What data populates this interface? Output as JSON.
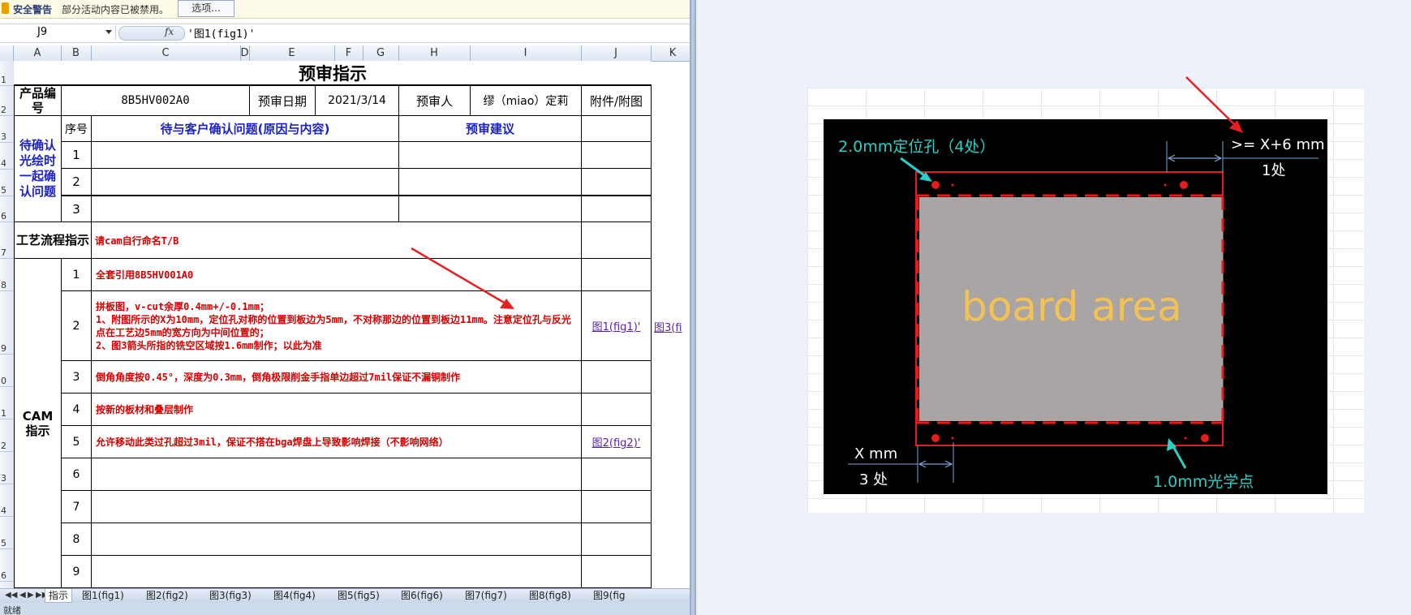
{
  "security_bar": {
    "title": "安全警告",
    "message": "部分活动内容已被禁用。",
    "options_button": "选项..."
  },
  "formula_bar": {
    "name_box": "J9",
    "fx": "fx",
    "formula": "'图1(fig1)'"
  },
  "columns": [
    "A",
    "B",
    "C",
    "D",
    "E",
    "F",
    "G",
    "H",
    "I",
    "J",
    "K"
  ],
  "rows": [
    "1",
    "2",
    "3",
    "4",
    "5",
    "6",
    "7",
    "8",
    "9",
    "0",
    "1",
    "2",
    "3",
    "4",
    "5",
    "6"
  ],
  "sheet": {
    "title": "预审指示",
    "product_label": "产品编号",
    "product_value": "8B5HV002A0",
    "date_label": "预审日期",
    "date_value": "2021/3/14",
    "reviewer_label": "预审人",
    "reviewer_value": "缪（miao）定莉",
    "attach_label": "附件/附图",
    "confirm_label": "待确认光绘时一起确认问题",
    "seq_label": "序号",
    "issue_header": "待与客户确认问题(原因与内容)",
    "suggest_header": "预审建议",
    "confirm_rows": [
      "1",
      "2",
      "3"
    ],
    "process_label": "工艺流程指示",
    "process_text": "请cam自行命名T/B",
    "cam_label": "CAM指示",
    "cam_rows": [
      {
        "no": "1",
        "text": "全套引用8B5HV001A0",
        "link": ""
      },
      {
        "no": "2",
        "text": "拼板图，v-cut余厚0.4mm+/-0.1mm；\n1、附图所示的X为10mm，定位孔对称的位置到板边为5mm，不对称那边的位置到板边11mm。注意定位孔与反光点在工艺边5mm的宽方向为中间位置的；\n2、图3箭头所指的铣空区域按1.6mm制作；以此为准",
        "link": "图1(fig1)'",
        "link2": "图3(fi"
      },
      {
        "no": "3",
        "text": "倒角角度按0.45°，深度为0.3mm，倒角极限削金手指单边超过7mil保证不漏铜制作",
        "link": ""
      },
      {
        "no": "4",
        "text": "按新的板材和叠层制作",
        "link": ""
      },
      {
        "no": "5",
        "text": "允许移动此类过孔超过3mil，保证不搭在bga焊盘上导致影响焊接（不影响网络）",
        "link": "图2(fig2)'"
      },
      {
        "no": "6",
        "text": "",
        "link": ""
      },
      {
        "no": "7",
        "text": "",
        "link": ""
      },
      {
        "no": "8",
        "text": "",
        "link": ""
      },
      {
        "no": "9",
        "text": "",
        "link": ""
      }
    ]
  },
  "sheet_tabs": [
    "指示",
    "图1(fig1)",
    "图2(fig2)",
    "图3(fig3)",
    "图4(fig4)",
    "图5(fig5)",
    "图6(fig6)",
    "图7(fig7)",
    "图8(fig8)",
    "图9(fig"
  ],
  "status_text": "就绪",
  "figure": {
    "hole_label": "2.0mm定位孔（4处）",
    "top_dim": ">= X+6 mm",
    "top_count": "1处",
    "board_text": "board area",
    "x_label": "X mm",
    "x_count": "3 处",
    "fiducial_label": "1.0mm光学点"
  },
  "colors": {
    "warning_red": "#d40000",
    "heading_blue": "#1c22c8",
    "figure_cyan": "#2ad0c8",
    "board_gray": "#a9a5a4",
    "board_text": "#f2c257"
  }
}
